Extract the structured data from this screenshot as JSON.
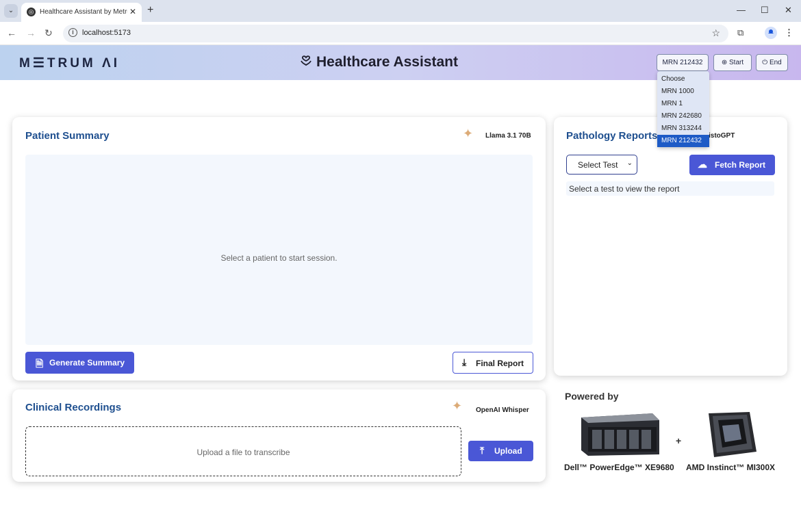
{
  "browser": {
    "tab_title": "Healthcare Assistant by Metrum",
    "url": "localhost:5173"
  },
  "header": {
    "logo": "M☰TRUM ΛI",
    "title": "Healthcare Assistant",
    "mrn_selected": "MRN 212432",
    "start_label": "Start",
    "end_label": "End"
  },
  "mrn_dropdown": {
    "options": [
      "Choose",
      "MRN 1000",
      "MRN 1",
      "MRN 242680",
      "MRN 313244",
      "MRN 212432"
    ],
    "selected": "MRN 212432"
  },
  "patient_summary": {
    "title": "Patient Summary",
    "model": "Llama 3.1 70B",
    "placeholder": "Select a patient to start session.",
    "generate_label": "Generate Summary",
    "final_report_label": "Final Report"
  },
  "pathology": {
    "title": "Pathology Reports",
    "model_suffix": "istoGPT",
    "select_label": "Select Test",
    "fetch_label": "Fetch Report",
    "report_placeholder": "Select a test to view the report"
  },
  "clinical": {
    "title": "Clinical Recordings",
    "model": "OpenAI Whisper",
    "upload_zone_text": "Upload a file to transcribe",
    "upload_label": "Upload"
  },
  "powered_by": {
    "heading": "Powered by",
    "plus": "+",
    "product1": "Dell™ PowerEdge™ XE9680",
    "product2": "AMD Instinct™ MI300X"
  },
  "colors": {
    "accent": "#4a57d6",
    "title_blue": "#1e4f8f",
    "selected_option": "#1e5bc6"
  }
}
